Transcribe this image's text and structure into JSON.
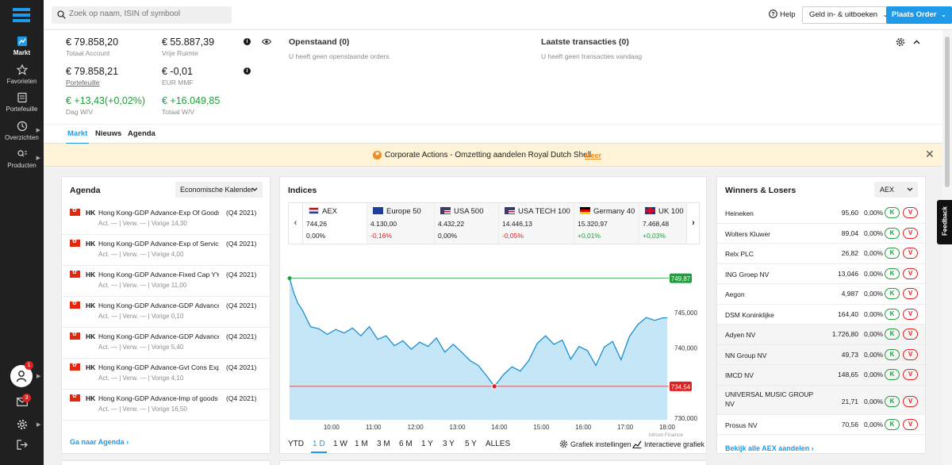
{
  "sidebar": {
    "items": [
      {
        "label": "Markt",
        "icon": "chart-icon"
      },
      {
        "label": "Favorieten",
        "icon": "star-icon"
      },
      {
        "label": "Portefeuille",
        "icon": "portfolio-icon"
      },
      {
        "label": "Overzichten",
        "icon": "clock-icon"
      },
      {
        "label": "Producten",
        "icon": "products-icon"
      }
    ],
    "avatar_badge": "1",
    "mail_badge": "3"
  },
  "topbar": {
    "search_placeholder": "Zoek op naam, ISIN of symbool",
    "help_label": "Help",
    "cash_button": "Geld in- & uitboeken",
    "order_button": "Plaats Order"
  },
  "account": {
    "total_value": "€ 79.858,20",
    "total_label": "Totaal Account",
    "free_value": "€ 55.887,39",
    "free_label": "Vrije Ruimte",
    "portfolio_value": "€ 79.858,21",
    "portfolio_label": "Portefeuille",
    "mmf_value": "€ -0,01",
    "mmf_label": "EUR MMF",
    "day_value": "€ +13,43(+0,02%)",
    "day_label": "Dag W/V",
    "total_pl_value": "€ +16.049,85",
    "total_pl_label": "Totaal W/V",
    "open_title": "Openstaand (0)",
    "open_sub": "U heeft geen openstaande orders",
    "tx_title": "Laatste transacties (0)",
    "tx_sub": "U heeft geen transacties vandaag"
  },
  "tabs": [
    "Markt",
    "Nieuws",
    "Agenda"
  ],
  "banner": {
    "text": "Corporate Actions - Omzetting aandelen Royal Dutch Shell",
    "link": "Meer"
  },
  "agenda": {
    "title": "Agenda",
    "dropdown": "Economische Kalender",
    "rows": [
      {
        "cc": "HK",
        "name": "Hong Kong-GDP Advance-Exp Of Goods ...",
        "q": "(Q4 2021)",
        "sub": "Act. — | Verw. — | Vorige 14,30"
      },
      {
        "cc": "HK",
        "name": "Hong Kong-GDP Advance-Exp of Service...",
        "q": "(Q4 2021)",
        "sub": "Act. — | Verw. — | Vorige 4,00"
      },
      {
        "cc": "HK",
        "name": "Hong Kong-GDP Advance-Fixed Cap YY ...",
        "q": "(Q4 2021)",
        "sub": "Act. — | Verw. — | Vorige 11,00"
      },
      {
        "cc": "HK",
        "name": "Hong Kong-GDP Advance-GDP Advance ...",
        "q": "(Q4 2021)",
        "sub": "Act. — | Verw. — | Vorige 0,10"
      },
      {
        "cc": "HK",
        "name": "Hong Kong-GDP Advance-GDP Advance ...",
        "q": "(Q4 2021)",
        "sub": "Act. — | Verw. — | Vorige 5,40"
      },
      {
        "cc": "HK",
        "name": "Hong Kong-GDP Advance-Gvt Cons Exp ...",
        "q": "(Q4 2021)",
        "sub": "Act. — | Verw. — | Vorige 4,10"
      },
      {
        "cc": "HK",
        "name": "Hong Kong-GDP Advance-Imp of goods ...",
        "q": "(Q4 2021)",
        "sub": "Act. — | Verw. — | Vorige 16,50"
      }
    ],
    "footer_link": "Ga naar Agenda"
  },
  "indices": {
    "title": "Indices",
    "cards": [
      {
        "name": "AEX",
        "flag": "nl",
        "price": "744,26",
        "change": "0,00%",
        "dir": "flat"
      },
      {
        "name": "Europe 50",
        "flag": "eu",
        "price": "4.130,00",
        "change": "-0,16%",
        "dir": "down"
      },
      {
        "name": "USA 500",
        "flag": "us",
        "price": "4.432,22",
        "change": "0,00%",
        "dir": "flat"
      },
      {
        "name": "USA TECH 100",
        "flag": "us",
        "price": "14.446,13",
        "change": "-0,05%",
        "dir": "down"
      },
      {
        "name": "Germany 40",
        "flag": "de",
        "price": "15.320,97",
        "change": "+0,01%",
        "dir": "up"
      },
      {
        "name": "UK 100",
        "flag": "uk",
        "price": "7.468,48",
        "change": "+0,03%",
        "dir": "up"
      }
    ],
    "source": "Infront Finance",
    "periods": [
      "YTD",
      "1 D",
      "1 W",
      "1 M",
      "3 M",
      "6 M",
      "1 Y",
      "3 Y",
      "5 Y",
      "ALLES"
    ],
    "active_period": "1 D",
    "settings_label": "Grafiek instellingen",
    "interactive_label": "Interactieve grafiek"
  },
  "chart_data": {
    "type": "area",
    "x_ticks": [
      "10:00",
      "11:00",
      "12:00",
      "13:00",
      "14:00",
      "15:00",
      "16:00",
      "17:00",
      "18:00"
    ],
    "y_ticks": [
      "745,000",
      "740,000",
      "730,000"
    ],
    "ylim": [
      729.8,
      750.5
    ],
    "high_label": "749,87",
    "low_label": "734,54",
    "high": 749.87,
    "low": 734.54,
    "high_at": "09:00",
    "low_at": "13:53",
    "colors": {
      "fill": "#c5e6f6",
      "line": "#1a8fd0",
      "high": "#1f9e3c",
      "low": "#e02020"
    },
    "x": [
      "09:00",
      "09:06",
      "09:12",
      "09:18",
      "09:24",
      "09:30",
      "09:42",
      "09:54",
      "10:06",
      "10:18",
      "10:30",
      "10:42",
      "10:54",
      "11:06",
      "11:18",
      "11:30",
      "11:42",
      "11:54",
      "12:06",
      "12:18",
      "12:30",
      "12:42",
      "12:54",
      "13:06",
      "13:18",
      "13:30",
      "13:42",
      "13:53",
      "14:06",
      "14:18",
      "14:30",
      "14:42",
      "14:54",
      "15:06",
      "15:18",
      "15:30",
      "15:42",
      "15:54",
      "16:06",
      "16:18",
      "16:30",
      "16:42",
      "16:54",
      "17:06",
      "17:18",
      "17:30",
      "17:42",
      "17:54",
      "18:00"
    ],
    "y": [
      749.87,
      747.8,
      746.3,
      745.4,
      744.2,
      743.0,
      742.7,
      741.9,
      742.6,
      742.1,
      742.8,
      741.7,
      743.0,
      741.2,
      741.7,
      740.3,
      741.0,
      739.8,
      740.8,
      740.2,
      741.4,
      739.4,
      740.5,
      739.4,
      738.2,
      737.5,
      736.0,
      734.54,
      736.2,
      737.3,
      736.7,
      738.2,
      740.6,
      741.7,
      740.5,
      741.1,
      738.4,
      740.2,
      739.6,
      737.5,
      740.1,
      740.9,
      738.3,
      741.6,
      743.3,
      744.3,
      743.9,
      744.26,
      744.26
    ]
  },
  "winners": {
    "title": "Winners & Losers",
    "dropdown": "AEX",
    "rows": [
      {
        "name": "Heineken",
        "price": "95,60",
        "pct": "0,00%"
      },
      {
        "name": "Wolters Kluwer",
        "price": "89,04",
        "pct": "0,00%"
      },
      {
        "name": "Relx PLC",
        "price": "26,82",
        "pct": "0,00%"
      },
      {
        "name": "ING Groep NV",
        "price": "13,046",
        "pct": "0,00%"
      },
      {
        "name": "Aegon",
        "price": "4,987",
        "pct": "0,00%"
      },
      {
        "name": "DSM Koninklijke",
        "price": "164,40",
        "pct": "0,00%"
      },
      {
        "name": "Adyen NV",
        "price": "1.726,80",
        "pct": "0,00%"
      },
      {
        "name": "NN Group NV",
        "price": "49,73",
        "pct": "0,00%"
      },
      {
        "name": "IMCD NV",
        "price": "148,65",
        "pct": "0,00%"
      },
      {
        "name": "UNIVERSAL MUSIC GROUP NV",
        "price": "21,71",
        "pct": "0,00%"
      },
      {
        "name": "Prosus NV",
        "price": "70,56",
        "pct": "0,00%"
      }
    ],
    "buy_label": "K",
    "sell_label": "V",
    "footer_link": "Bekijk alle AEX aandelen"
  },
  "feedback_label": "Feedback"
}
